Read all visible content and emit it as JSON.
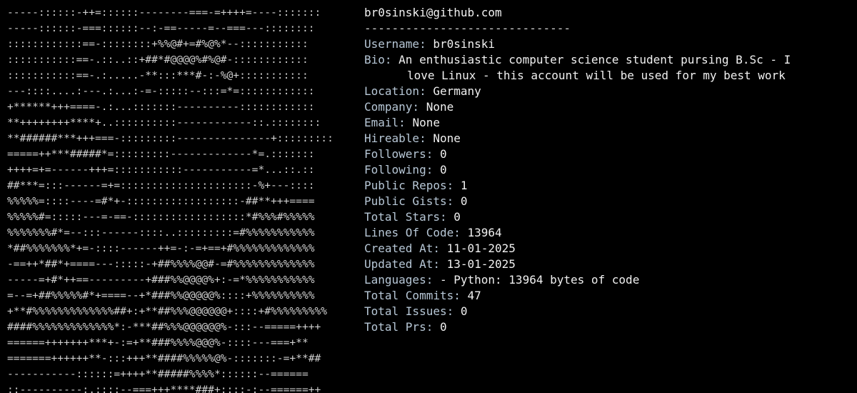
{
  "window": {
    "colors": {
      "background": "#000000",
      "label": "#b7c7d6",
      "text": "#f0f0f0"
    }
  },
  "ascii_art": [
    "-----::::::-++=::::::--------===-=++++=----:::::::",
    "-----::::::-===::::::--:-==-----=--===---::::::::",
    "::::::::::::==-::::::::+%%@#+=#%@%*--:::::::::::",
    ":::::::::::==-.::..::+##*#@@@@%#%@#-::::::::::::",
    ":::::::::::==-.:.....-**:::***#-:-%@+:::::::::::",
    "---::::....:---.:...:-=-:::::--:::=*=::::::::::::",
    "+******+++====-.:...:::::::----------::::::::::::",
    "**++++++++****+..::::::::::------------::.::::::::",
    "**######***+++===-:::::::::---------------+:::::::::",
    "=====++***#####*=:::::::::-------------*=.:::::::",
    "++++=+=------+++=:::::::::::-----------=*...::.::",
    "##***=:::------=+=:::::::::::::::::::::-%+---::::",
    "%%%%%=::::----=#*+-::::::::::::::::::-##**+++====",
    "%%%%%#=:::::---=-==-::::::::::::::::::*#%%%#%%%%%",
    "%%%%%%%#*=--:::------::::..:::::::::=#%%%%%%%%%%%",
    "*##%%%%%%%*+=-::::------++=-:-=+==+#%%%%%%%%%%%%%",
    "-==++*##*+====---:::::-+##%%%%@@#-=#%%%%%%%%%%%%%",
    "-----=+#*++==---------+###%%@@@@%+:-=*%%%%%%%%%%%",
    "=--=+##%%%%%#*+====--+*###%%@@@@@%::::+%%%%%%%%%%",
    "+**#%%%%%%%%%%%%%##+:+**##%%%@@@@@@+::::+#%%%%%%%%%",
    "####%%%%%%%%%%%%%*:-***##%%%@@@@@@%-:::--=====++++",
    "======+++++++***+-:=+**###%%%%@@@%-::::---===+**",
    "=======++++++**-:::+++**####%%%%%@%-:::::::-=+**##",
    "-----------::::::=++++**#####%%%%*::::::--======",
    "::----------:.::::--===+++****###+::::-:--======++"
  ],
  "header": {
    "title": "br0sinski@github.com",
    "separator": "------------------------------"
  },
  "info": {
    "username": {
      "label": "Username:",
      "value": "br0sinski"
    },
    "bio": {
      "label": "Bio:",
      "line1": "An enthusiastic computer science student pursing B.Sc - I",
      "line2": "love Linux - this account will be used for my best work"
    },
    "location": {
      "label": "Location:",
      "value": "Germany"
    },
    "company": {
      "label": "Company:",
      "value": "None"
    },
    "email": {
      "label": "Email:",
      "value": "None"
    },
    "hireable": {
      "label": "Hireable:",
      "value": "None"
    },
    "followers": {
      "label": "Followers:",
      "value": "0"
    },
    "following": {
      "label": "Following:",
      "value": "0"
    },
    "public_repos": {
      "label": "Public Repos:",
      "value": "1"
    },
    "public_gists": {
      "label": "Public Gists:",
      "value": "0"
    },
    "total_stars": {
      "label": "Total Stars:",
      "value": "0"
    },
    "lines_of_code": {
      "label": "Lines Of Code:",
      "value": "13964"
    },
    "created_at": {
      "label": "Created At:",
      "value": "11-01-2025"
    },
    "updated_at": {
      "label": "Updated At:",
      "value": "13-01-2025"
    },
    "languages": {
      "label": "Languages:",
      "value": "- Python: 13964 bytes of code"
    },
    "total_commits": {
      "label": "Total Commits:",
      "value": "47"
    },
    "total_issues": {
      "label": "Total Issues:",
      "value": "0"
    },
    "total_prs": {
      "label": "Total Prs:",
      "value": "0"
    }
  }
}
